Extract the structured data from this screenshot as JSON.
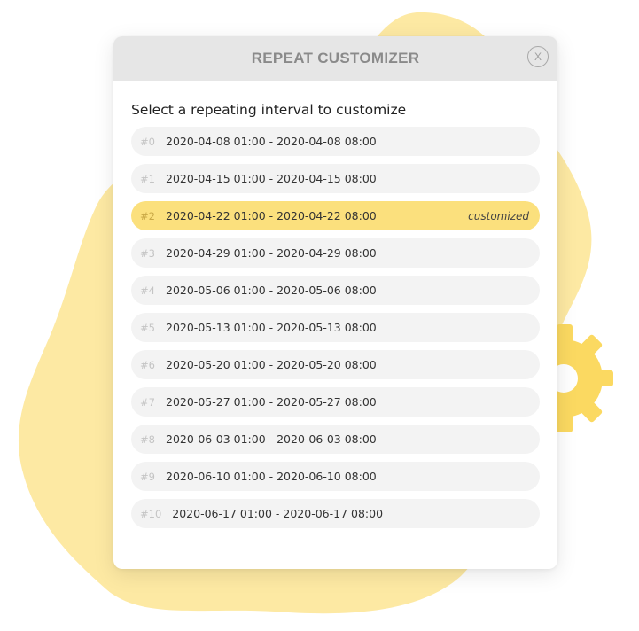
{
  "modal": {
    "title": "REPEAT CUSTOMIZER",
    "close_label": "X",
    "subtitle": "Select a repeating interval to customize"
  },
  "intervals": [
    {
      "index": "#0",
      "range": "2020-04-08 01:00 - 2020-04-08 08:00",
      "badge": ""
    },
    {
      "index": "#1",
      "range": "2020-04-15 01:00 - 2020-04-15 08:00",
      "badge": ""
    },
    {
      "index": "#2",
      "range": "2020-04-22 01:00 - 2020-04-22 08:00",
      "badge": "customized"
    },
    {
      "index": "#3",
      "range": "2020-04-29 01:00 - 2020-04-29 08:00",
      "badge": ""
    },
    {
      "index": "#4",
      "range": "2020-05-06 01:00 - 2020-05-06 08:00",
      "badge": ""
    },
    {
      "index": "#5",
      "range": "2020-05-13 01:00 - 2020-05-13 08:00",
      "badge": ""
    },
    {
      "index": "#6",
      "range": "2020-05-20 01:00 - 2020-05-20 08:00",
      "badge": ""
    },
    {
      "index": "#7",
      "range": "2020-05-27 01:00 - 2020-05-27 08:00",
      "badge": ""
    },
    {
      "index": "#8",
      "range": "2020-06-03 01:00 - 2020-06-03 08:00",
      "badge": ""
    },
    {
      "index": "#9",
      "range": "2020-06-10 01:00 - 2020-06-10 08:00",
      "badge": ""
    },
    {
      "index": "#10",
      "range": "2020-06-17 01:00 - 2020-06-17 08:00",
      "badge": ""
    }
  ],
  "colors": {
    "accent_yellow": "#fbe07d",
    "blob_yellow": "#fde9a3",
    "gear_yellow": "#fbd961",
    "header_gray": "#e6e6e6",
    "row_gray": "#f3f3f3"
  },
  "icons": {
    "close": "close-icon",
    "decoration": "gear-icon"
  }
}
